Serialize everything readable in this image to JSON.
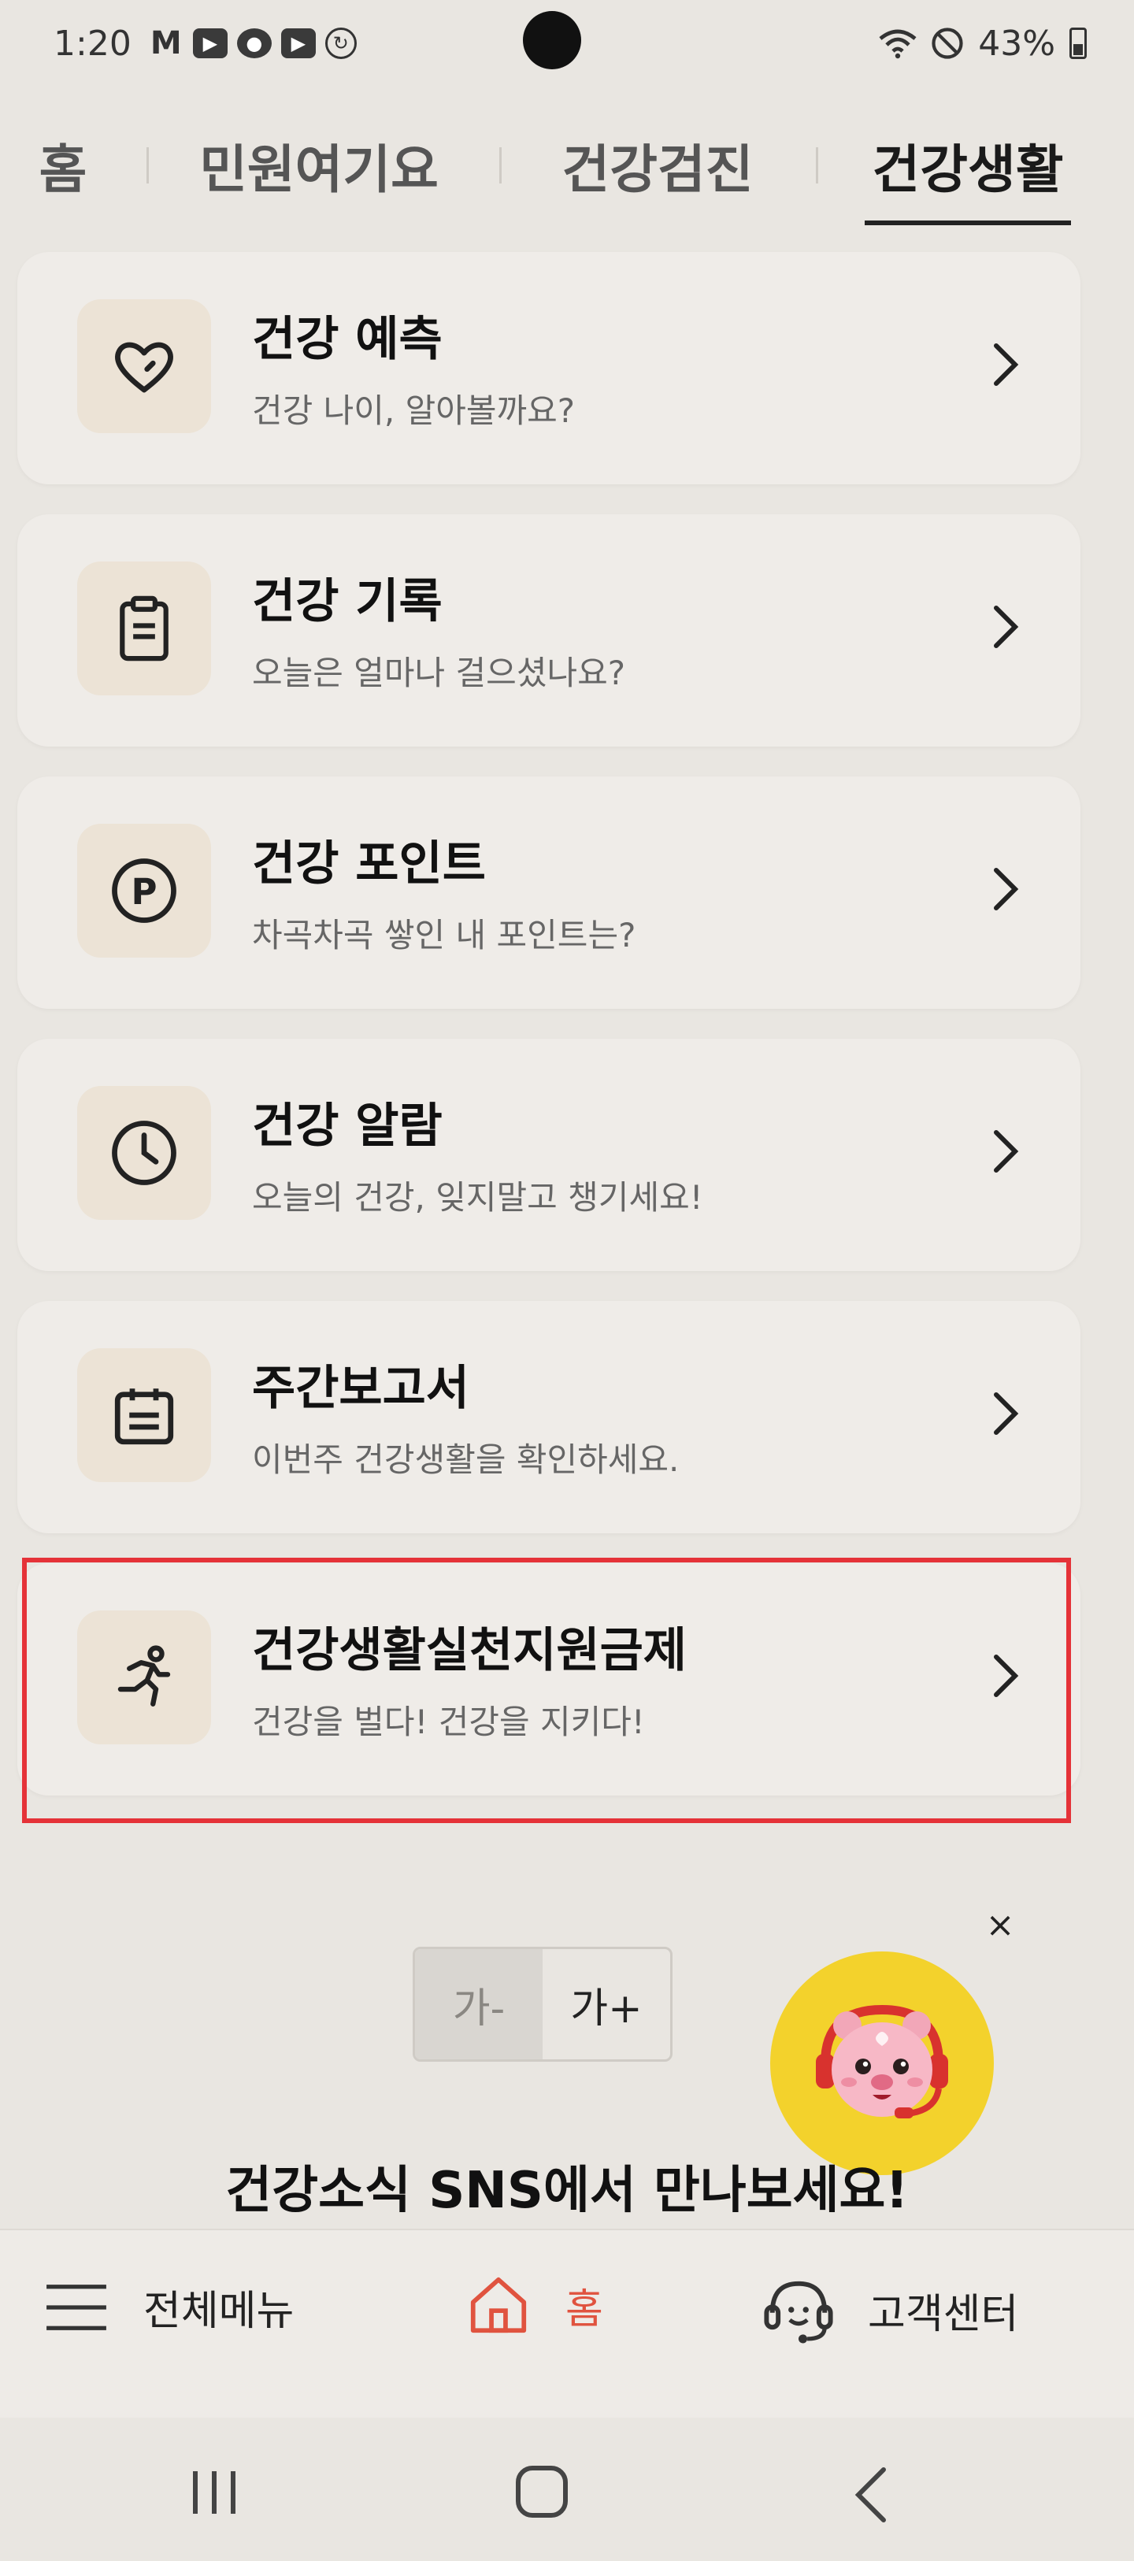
{
  "status_bar": {
    "time": "1:20",
    "battery": "43%",
    "notification_icons": [
      "mail-icon",
      "youtube-icon",
      "account-icon",
      "youtube-icon",
      "sync-icon"
    ]
  },
  "tabs": [
    {
      "label": "홈",
      "active": false
    },
    {
      "label": "민원여기요",
      "active": false
    },
    {
      "label": "건강검진",
      "active": false
    },
    {
      "label": "건강생활",
      "active": true
    }
  ],
  "cards": [
    {
      "title": "건강 예측",
      "subtitle": "건강 나이, 알아볼까요?",
      "icon": "heart-icon"
    },
    {
      "title": "건강 기록",
      "subtitle": "오늘은 얼마나 걸으셨나요?",
      "icon": "clipboard-icon"
    },
    {
      "title": "건강 포인트",
      "subtitle": "차곡차곡 쌓인 내 포인트는?",
      "icon": "point-icon"
    },
    {
      "title": "건강 알람",
      "subtitle": "오늘의 건강, 잊지말고 챙기세요!",
      "icon": "clock-icon"
    },
    {
      "title": "주간보고서",
      "subtitle": "이번주 건강생활을 확인하세요.",
      "icon": "calendar-icon"
    },
    {
      "title": "건강생활실천지원금제",
      "subtitle": "건강을 벌다! 건강을 지키다!",
      "icon": "running-icon"
    }
  ],
  "font_toggle": {
    "small": "가-",
    "large": "가+"
  },
  "chatbot": {
    "close": "×"
  },
  "sns_heading": "건강소식 SNS에서 만나보세요!",
  "bottom_nav": {
    "menu": "전체메뉴",
    "home": "홈",
    "support": "고객센터"
  },
  "colors": {
    "highlight": "#e53238",
    "accent": "#e0533f",
    "chatbot_bg": "#f3d22c"
  }
}
